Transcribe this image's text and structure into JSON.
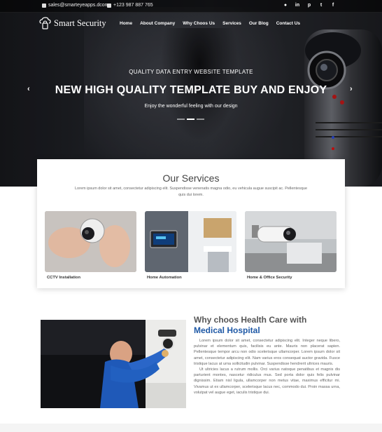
{
  "topbar": {
    "email": "sales@smarteyeapps.dcom",
    "phone": "+123 987 887 765",
    "social": [
      "github",
      "linkedin",
      "pinterest",
      "twitter",
      "facebook"
    ]
  },
  "brand": {
    "name": "Smart Security"
  },
  "nav": {
    "items": [
      "Home",
      "About Company",
      "Why Choos Us",
      "Services",
      "Our Blog",
      "Contact Us"
    ]
  },
  "hero": {
    "subtitle": "QUALITY DATA ENTRY WEBSITE TEMPLATE",
    "title": "NEW HIGH QUALITY TEMPLATE BUY AND ENJOY",
    "tagline": "Enjoy the wonderful feeling with our design",
    "prev_arrow": "‹",
    "next_arrow": "›"
  },
  "services": {
    "title": "Our Services",
    "description": "Lorem ipsum dolor sit amet, consectetur adipiscing elit. Suspendisse venenatis magna odio, eu vehicula augue suscipit ac. Pellentesque quis dui lorem.",
    "cards": [
      {
        "label": "CCTV Installation"
      },
      {
        "label": "Home Automation"
      },
      {
        "label": "Home & Office Security"
      }
    ]
  },
  "why": {
    "title_line1": "Why choos Health Care with",
    "title_line2": "Medical Hospital",
    "paragraph1": "Lorem ipsum dolor sit amet, consectetur adipiscing elit. Integer neque libero, pulvinar et elementum quis, facilisis eu ante. Mauris non placerat sapien. Pellentesque tempor arcu non odio scelerisque ullamcorper. Lorem ipsum dolor sit amet, consectetur adipiscing elit. Nam varius eros consequat auctor gravida. Fusce tristique lacus at urna sollicitudin pulvinar. Suspendisse hendrerit ultrices mauris.",
    "paragraph2": "Ut ultricies lacus a rutrum mollis. Orci varius natoque penatibus et magnis dis parturient montes, nascetur ridiculus mus. Sed porta dolor quis felis pulvinar dignissim. Etiam nisl ligula, ullamcorper non metus vitae, maximus efficitur mi. Vivamus ut ex ullamcorper, scelerisque lacus nec, commodo dui. Proin massa urna, volutpat vel augue eget, iaculis tristique dui."
  },
  "colors": {
    "accent_blue": "#1f59a6",
    "hero_dark": "#1c1d21"
  }
}
